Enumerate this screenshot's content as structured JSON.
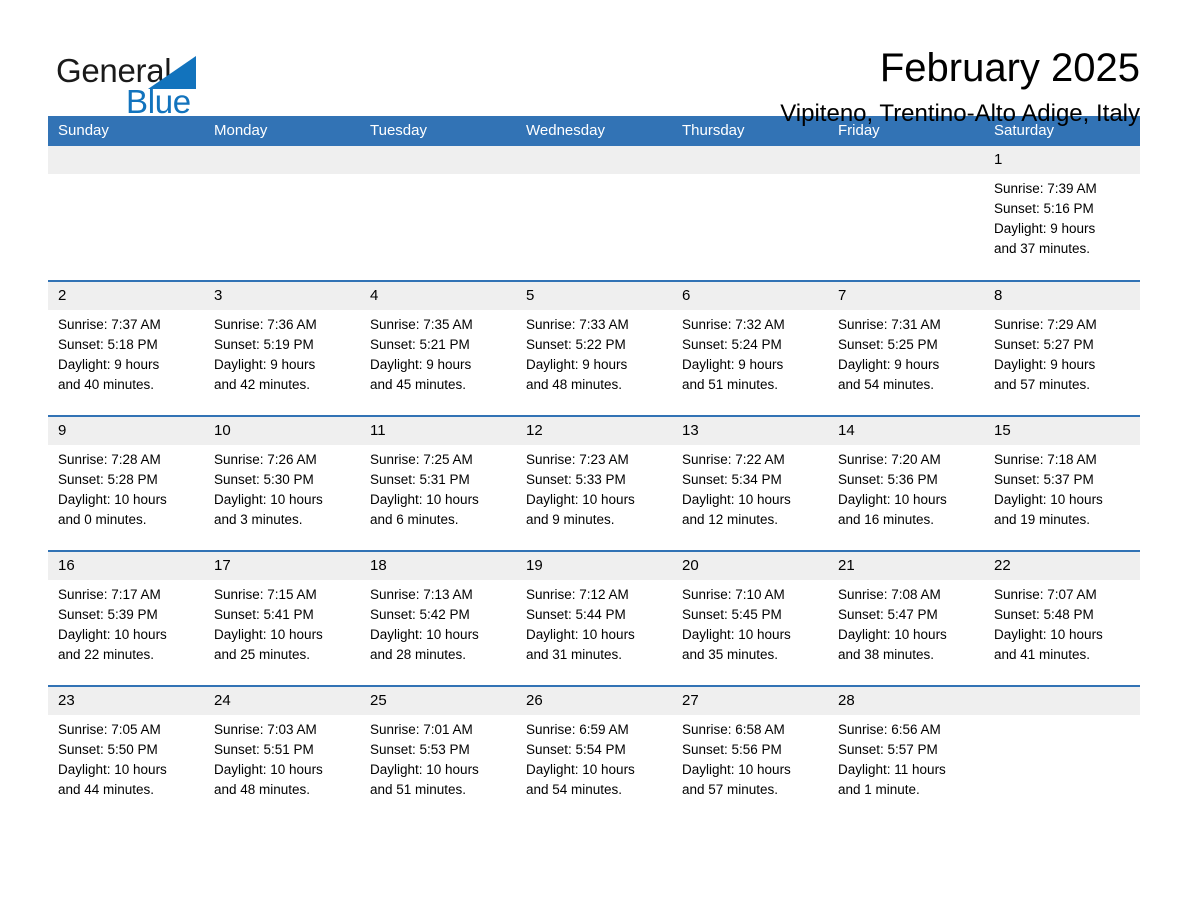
{
  "brand": {
    "name_part1": "General",
    "name_part2": "Blue",
    "triangle_color": "#1273bd"
  },
  "header": {
    "title": "February 2025",
    "subtitle": "Vipiteno, Trentino-Alto Adige, Italy"
  },
  "theme": {
    "header_blue": "#3273b5",
    "daynum_band": "#efefef",
    "text": "#000000"
  },
  "weekday_headers": [
    "Sunday",
    "Monday",
    "Tuesday",
    "Wednesday",
    "Thursday",
    "Friday",
    "Saturday"
  ],
  "weeks": [
    [
      {
        "empty": true
      },
      {
        "empty": true
      },
      {
        "empty": true
      },
      {
        "empty": true
      },
      {
        "empty": true
      },
      {
        "empty": true
      },
      {
        "day": "1",
        "sunrise": "Sunrise: 7:39 AM",
        "sunset": "Sunset: 5:16 PM",
        "daylight_line1": "Daylight: 9 hours",
        "daylight_line2": "and 37 minutes."
      }
    ],
    [
      {
        "day": "2",
        "sunrise": "Sunrise: 7:37 AM",
        "sunset": "Sunset: 5:18 PM",
        "daylight_line1": "Daylight: 9 hours",
        "daylight_line2": "and 40 minutes."
      },
      {
        "day": "3",
        "sunrise": "Sunrise: 7:36 AM",
        "sunset": "Sunset: 5:19 PM",
        "daylight_line1": "Daylight: 9 hours",
        "daylight_line2": "and 42 minutes."
      },
      {
        "day": "4",
        "sunrise": "Sunrise: 7:35 AM",
        "sunset": "Sunset: 5:21 PM",
        "daylight_line1": "Daylight: 9 hours",
        "daylight_line2": "and 45 minutes."
      },
      {
        "day": "5",
        "sunrise": "Sunrise: 7:33 AM",
        "sunset": "Sunset: 5:22 PM",
        "daylight_line1": "Daylight: 9 hours",
        "daylight_line2": "and 48 minutes."
      },
      {
        "day": "6",
        "sunrise": "Sunrise: 7:32 AM",
        "sunset": "Sunset: 5:24 PM",
        "daylight_line1": "Daylight: 9 hours",
        "daylight_line2": "and 51 minutes."
      },
      {
        "day": "7",
        "sunrise": "Sunrise: 7:31 AM",
        "sunset": "Sunset: 5:25 PM",
        "daylight_line1": "Daylight: 9 hours",
        "daylight_line2": "and 54 minutes."
      },
      {
        "day": "8",
        "sunrise": "Sunrise: 7:29 AM",
        "sunset": "Sunset: 5:27 PM",
        "daylight_line1": "Daylight: 9 hours",
        "daylight_line2": "and 57 minutes."
      }
    ],
    [
      {
        "day": "9",
        "sunrise": "Sunrise: 7:28 AM",
        "sunset": "Sunset: 5:28 PM",
        "daylight_line1": "Daylight: 10 hours",
        "daylight_line2": "and 0 minutes."
      },
      {
        "day": "10",
        "sunrise": "Sunrise: 7:26 AM",
        "sunset": "Sunset: 5:30 PM",
        "daylight_line1": "Daylight: 10 hours",
        "daylight_line2": "and 3 minutes."
      },
      {
        "day": "11",
        "sunrise": "Sunrise: 7:25 AM",
        "sunset": "Sunset: 5:31 PM",
        "daylight_line1": "Daylight: 10 hours",
        "daylight_line2": "and 6 minutes."
      },
      {
        "day": "12",
        "sunrise": "Sunrise: 7:23 AM",
        "sunset": "Sunset: 5:33 PM",
        "daylight_line1": "Daylight: 10 hours",
        "daylight_line2": "and 9 minutes."
      },
      {
        "day": "13",
        "sunrise": "Sunrise: 7:22 AM",
        "sunset": "Sunset: 5:34 PM",
        "daylight_line1": "Daylight: 10 hours",
        "daylight_line2": "and 12 minutes."
      },
      {
        "day": "14",
        "sunrise": "Sunrise: 7:20 AM",
        "sunset": "Sunset: 5:36 PM",
        "daylight_line1": "Daylight: 10 hours",
        "daylight_line2": "and 16 minutes."
      },
      {
        "day": "15",
        "sunrise": "Sunrise: 7:18 AM",
        "sunset": "Sunset: 5:37 PM",
        "daylight_line1": "Daylight: 10 hours",
        "daylight_line2": "and 19 minutes."
      }
    ],
    [
      {
        "day": "16",
        "sunrise": "Sunrise: 7:17 AM",
        "sunset": "Sunset: 5:39 PM",
        "daylight_line1": "Daylight: 10 hours",
        "daylight_line2": "and 22 minutes."
      },
      {
        "day": "17",
        "sunrise": "Sunrise: 7:15 AM",
        "sunset": "Sunset: 5:41 PM",
        "daylight_line1": "Daylight: 10 hours",
        "daylight_line2": "and 25 minutes."
      },
      {
        "day": "18",
        "sunrise": "Sunrise: 7:13 AM",
        "sunset": "Sunset: 5:42 PM",
        "daylight_line1": "Daylight: 10 hours",
        "daylight_line2": "and 28 minutes."
      },
      {
        "day": "19",
        "sunrise": "Sunrise: 7:12 AM",
        "sunset": "Sunset: 5:44 PM",
        "daylight_line1": "Daylight: 10 hours",
        "daylight_line2": "and 31 minutes."
      },
      {
        "day": "20",
        "sunrise": "Sunrise: 7:10 AM",
        "sunset": "Sunset: 5:45 PM",
        "daylight_line1": "Daylight: 10 hours",
        "daylight_line2": "and 35 minutes."
      },
      {
        "day": "21",
        "sunrise": "Sunrise: 7:08 AM",
        "sunset": "Sunset: 5:47 PM",
        "daylight_line1": "Daylight: 10 hours",
        "daylight_line2": "and 38 minutes."
      },
      {
        "day": "22",
        "sunrise": "Sunrise: 7:07 AM",
        "sunset": "Sunset: 5:48 PM",
        "daylight_line1": "Daylight: 10 hours",
        "daylight_line2": "and 41 minutes."
      }
    ],
    [
      {
        "day": "23",
        "sunrise": "Sunrise: 7:05 AM",
        "sunset": "Sunset: 5:50 PM",
        "daylight_line1": "Daylight: 10 hours",
        "daylight_line2": "and 44 minutes."
      },
      {
        "day": "24",
        "sunrise": "Sunrise: 7:03 AM",
        "sunset": "Sunset: 5:51 PM",
        "daylight_line1": "Daylight: 10 hours",
        "daylight_line2": "and 48 minutes."
      },
      {
        "day": "25",
        "sunrise": "Sunrise: 7:01 AM",
        "sunset": "Sunset: 5:53 PM",
        "daylight_line1": "Daylight: 10 hours",
        "daylight_line2": "and 51 minutes."
      },
      {
        "day": "26",
        "sunrise": "Sunrise: 6:59 AM",
        "sunset": "Sunset: 5:54 PM",
        "daylight_line1": "Daylight: 10 hours",
        "daylight_line2": "and 54 minutes."
      },
      {
        "day": "27",
        "sunrise": "Sunrise: 6:58 AM",
        "sunset": "Sunset: 5:56 PM",
        "daylight_line1": "Daylight: 10 hours",
        "daylight_line2": "and 57 minutes."
      },
      {
        "day": "28",
        "sunrise": "Sunrise: 6:56 AM",
        "sunset": "Sunset: 5:57 PM",
        "daylight_line1": "Daylight: 11 hours",
        "daylight_line2": "and 1 minute."
      },
      {
        "empty": true
      }
    ]
  ]
}
